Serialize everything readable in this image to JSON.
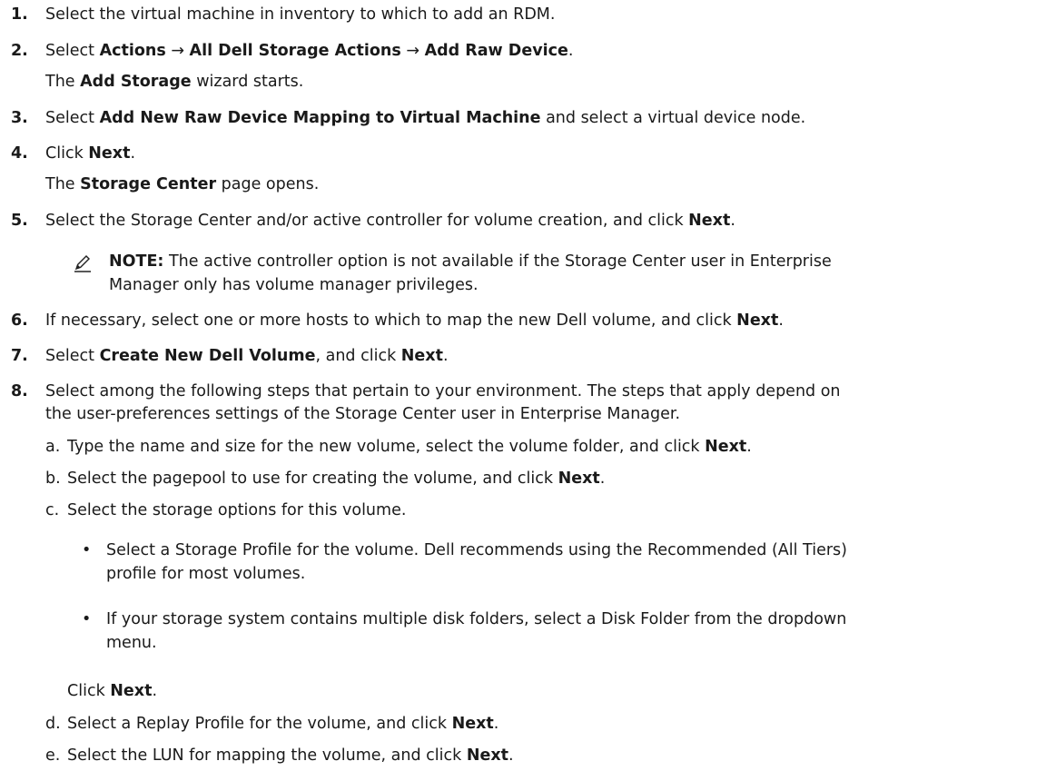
{
  "steps": [
    {
      "num": "1.",
      "text": "Select the virtual machine in inventory to which to add an RDM."
    },
    {
      "num": "2.",
      "pre": "Select ",
      "b1": "Actions",
      "arrow1": " → ",
      "b2": "All Dell Storage Actions",
      "arrow2": " → ",
      "b3": "Add Raw Device",
      "post": ".",
      "follow_pre": "The ",
      "follow_b": "Add Storage",
      "follow_post": " wizard starts."
    },
    {
      "num": "3.",
      "pre": "Select ",
      "b1": "Add New Raw Device Mapping to Virtual Machine",
      "post": " and select a virtual device node."
    },
    {
      "num": "4.",
      "pre": "Click ",
      "b1": "Next",
      "post": ".",
      "follow_pre": "The ",
      "follow_b": "Storage Center",
      "follow_post": " page opens."
    },
    {
      "num": "5.",
      "pre": "Select the Storage Center and/or active controller for volume creation, and click ",
      "b1": "Next",
      "post": "."
    },
    {
      "num": "6.",
      "pre": "If necessary, select one or more hosts to which to map the new Dell volume, and click ",
      "b1": "Next",
      "post": "."
    },
    {
      "num": "7.",
      "pre": "Select ",
      "b1": "Create New Dell Volume",
      "mid": ", and click ",
      "b2": "Next",
      "post": "."
    },
    {
      "num": "8.",
      "line1": "Select among the following steps that pertain to your environment. The steps that apply depend on",
      "line2": "the user-preferences settings of the Storage Center user in Enterprise Manager."
    }
  ],
  "note": {
    "label": "NOTE:",
    "line1": " The active controller option is not available if the Storage Center user in Enterprise",
    "line2": "Manager only has volume manager privileges."
  },
  "substeps": [
    {
      "letter": "a.",
      "pre": "Type the name and size for the new volume, select the volume folder, and click ",
      "b": "Next",
      "post": "."
    },
    {
      "letter": "b.",
      "pre": "Select the pagepool to use for creating the volume, and click ",
      "b": "Next",
      "post": "."
    },
    {
      "letter": "c.",
      "text": "Select the storage options for this volume."
    },
    {
      "letter": "d.",
      "pre": "Select a Replay Profile for the volume, and click ",
      "b": "Next",
      "post": "."
    },
    {
      "letter": "e.",
      "pre": "Select the LUN for mapping the volume, and click ",
      "b": "Next",
      "post": "."
    }
  ],
  "bullets": [
    {
      "dot": "•",
      "line1": "Select a Storage Profile for the volume. Dell recommends using the Recommended (All Tiers)",
      "line2": "profile for most volumes."
    },
    {
      "dot": "•",
      "line1": "If your storage system contains multiple disk folders, select a Disk Folder from the dropdown",
      "line2": "menu."
    }
  ],
  "click_next": {
    "pre": "Click ",
    "b": "Next",
    "post": "."
  }
}
